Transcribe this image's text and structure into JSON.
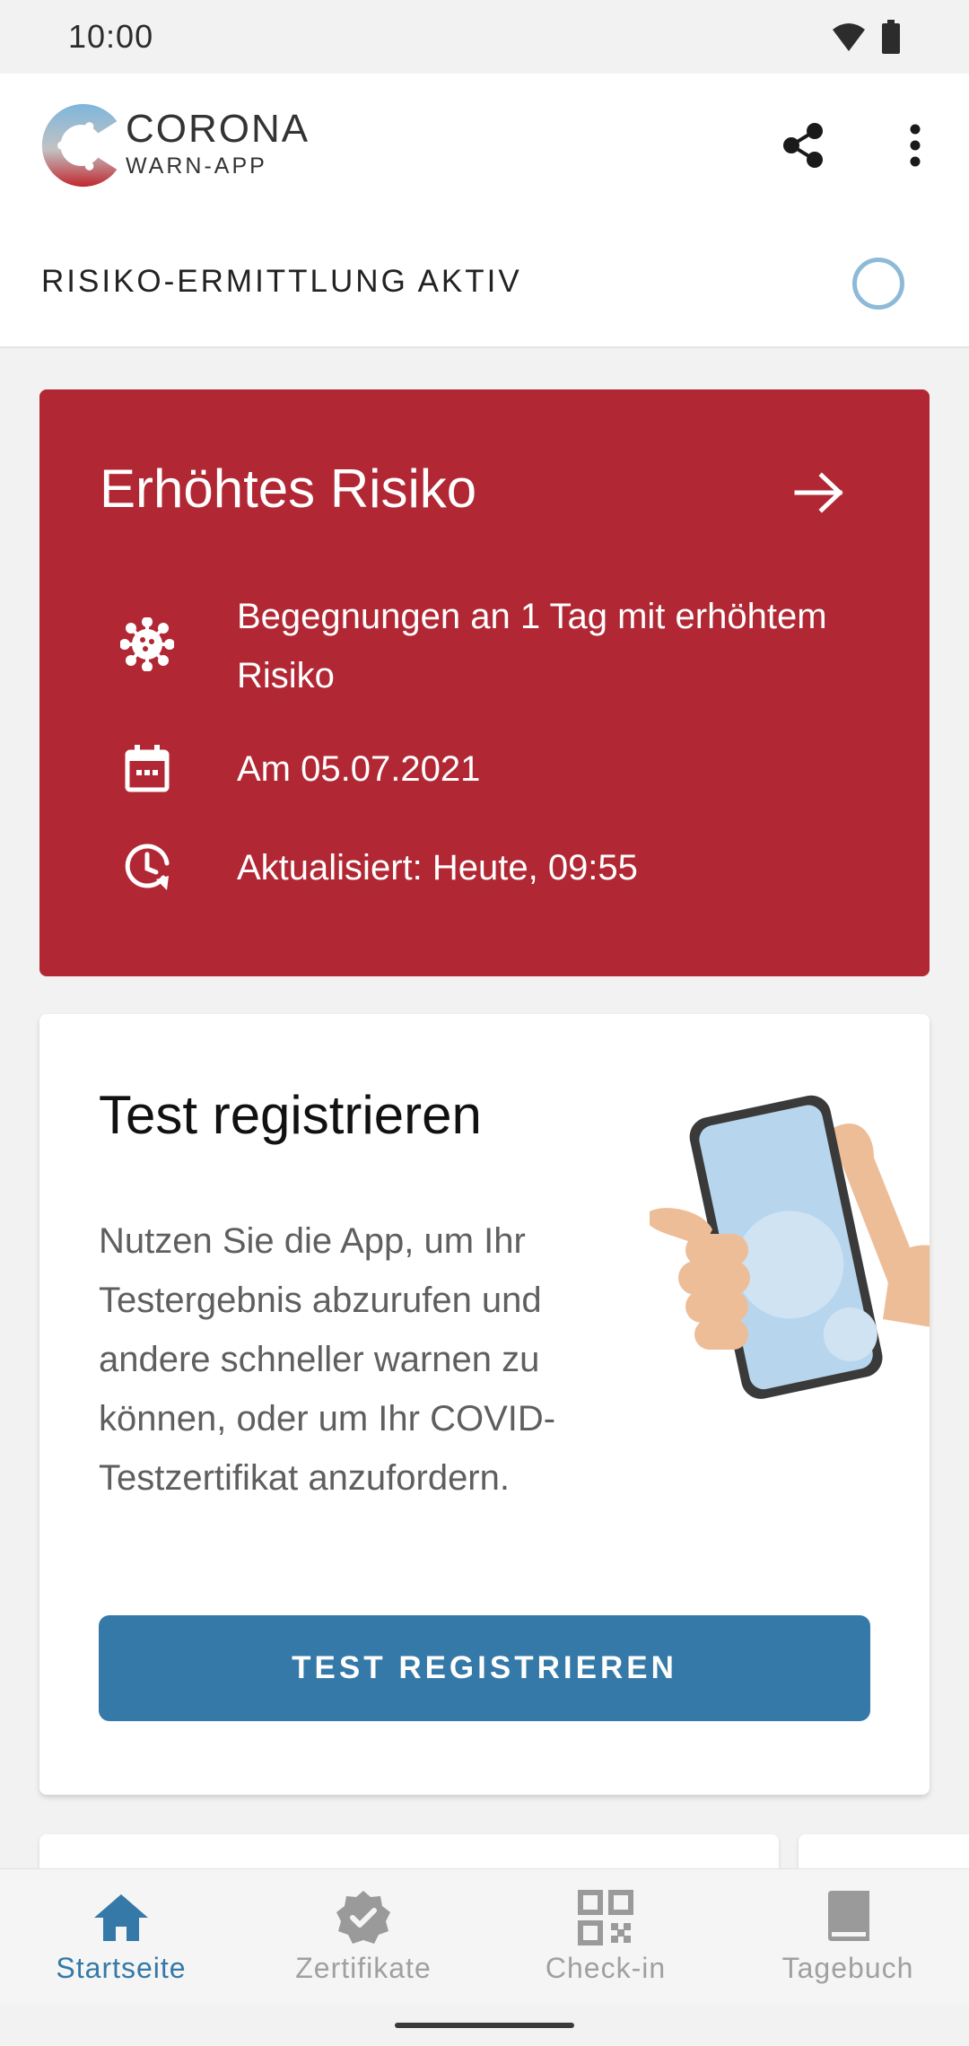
{
  "status_bar": {
    "time": "10:00"
  },
  "header": {
    "brand_title": "CORONA",
    "brand_subtitle": "WARN-APP",
    "tracing_status": "RISIKO-ERMITTLUNG AKTIV"
  },
  "risk_card": {
    "title": "Erhöhtes Risiko",
    "encounters": "Begegnungen an 1 Tag mit erhöhtem Risiko",
    "date": "Am 05.07.2021",
    "updated": "Aktualisiert: Heute, 09:55"
  },
  "test_card": {
    "title": "Test registrieren",
    "body": "Nutzen Sie die App, um Ihr Testergebnis abzurufen und andere schneller warnen zu können, oder um Ihr COVID-Testzertifikat anzufordern.",
    "button": "TEST REGISTRIEREN"
  },
  "bottom_nav": [
    {
      "label": "Startseite",
      "icon": "home-icon",
      "active": true
    },
    {
      "label": "Zertifikate",
      "icon": "certificate-badge-icon",
      "active": false
    },
    {
      "label": "Check-in",
      "icon": "qr-code-icon",
      "active": false
    },
    {
      "label": "Tagebuch",
      "icon": "book-icon",
      "active": false
    }
  ],
  "colors": {
    "risk_red": "#b12834",
    "primary_blue": "#3579a8",
    "tracing_ring": "#8ebad8"
  }
}
